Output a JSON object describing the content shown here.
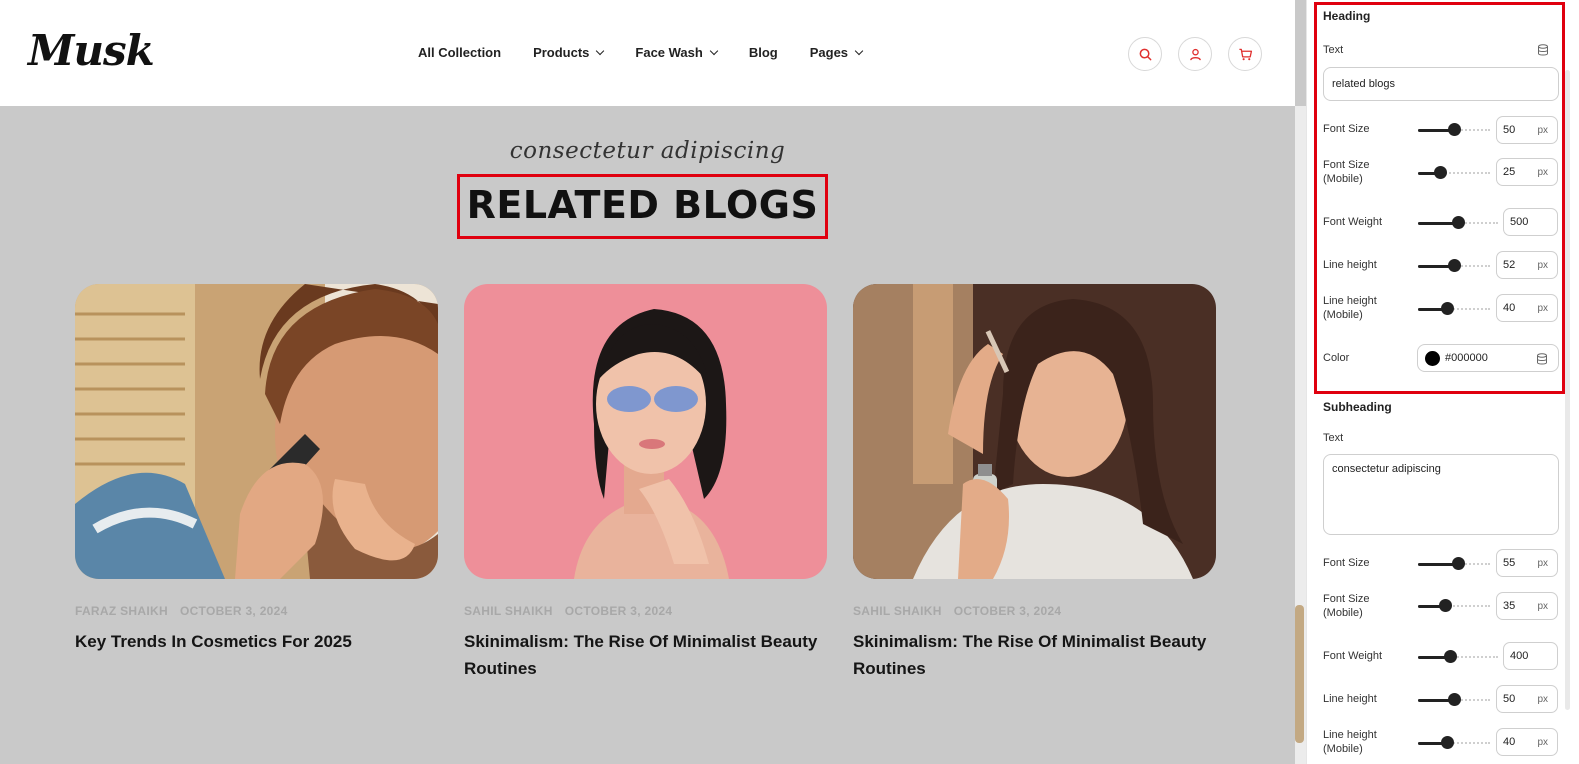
{
  "header": {
    "logo": "Musk",
    "nav": [
      {
        "label": "All Collection",
        "dropdown": false
      },
      {
        "label": "Products",
        "dropdown": true
      },
      {
        "label": "Face Wash",
        "dropdown": true
      },
      {
        "label": "Blog",
        "dropdown": false
      },
      {
        "label": "Pages",
        "dropdown": true
      }
    ],
    "icons": [
      "search-icon",
      "user-icon",
      "cart-icon"
    ],
    "accent_color": "#e0302f"
  },
  "section": {
    "subheading": "consectetur adipiscing",
    "heading": "RELATED BLOGS"
  },
  "posts": [
    {
      "author": "FARAZ SHAIKH",
      "date": "OCTOBER 3, 2024",
      "title": "Key Trends In Cosmetics For 2025"
    },
    {
      "author": "SAHIL SHAIKH",
      "date": "OCTOBER 3, 2024",
      "title": "Skinimalism: The Rise Of Minimalist Beauty Routines"
    },
    {
      "author": "SAHIL SHAIKH",
      "date": "OCTOBER 3, 2024",
      "title": "Skinimalism: The Rise Of Minimalist Beauty Routines"
    }
  ],
  "panel": {
    "heading": {
      "title": "Heading",
      "text_label": "Text",
      "text_value": "related blogs",
      "controls": [
        {
          "label": "Font Size",
          "value": "50",
          "unit": "px",
          "level": 0.5
        },
        {
          "label": "Font Size (Mobile)",
          "value": "25",
          "unit": "px",
          "level": 0.3
        },
        {
          "label": "Font Weight",
          "value": "500",
          "unit": "",
          "level": 0.5
        },
        {
          "label": "Line height",
          "value": "52",
          "unit": "px",
          "level": 0.5
        },
        {
          "label": "Line height (Mobile)",
          "value": "40",
          "unit": "px",
          "level": 0.4
        }
      ],
      "color_label": "Color",
      "color_value": "#000000"
    },
    "subheading": {
      "title": "Subheading",
      "text_label": "Text",
      "text_value": "consectetur adipiscing",
      "controls": [
        {
          "label": "Font Size",
          "value": "55",
          "unit": "px",
          "level": 0.55
        },
        {
          "label": "Font Size (Mobile)",
          "value": "35",
          "unit": "px",
          "level": 0.38
        },
        {
          "label": "Font Weight",
          "value": "400",
          "unit": "",
          "level": 0.4
        },
        {
          "label": "Line height",
          "value": "50",
          "unit": "px",
          "level": 0.5
        },
        {
          "label": "Line height (Mobile)",
          "value": "40",
          "unit": "px",
          "level": 0.4
        }
      ]
    }
  }
}
